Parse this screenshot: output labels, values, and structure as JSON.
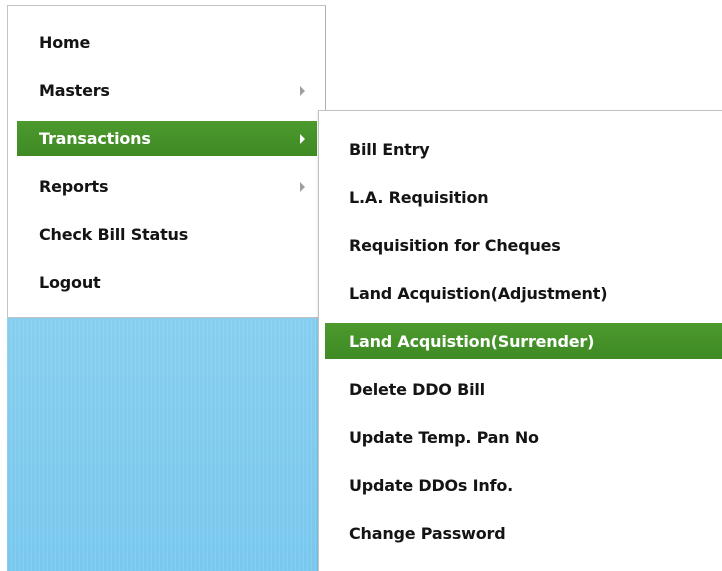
{
  "main_menu": {
    "items": [
      {
        "label": "Home",
        "has_submenu": false,
        "active": false
      },
      {
        "label": "Masters",
        "has_submenu": true,
        "active": false
      },
      {
        "label": "Transactions",
        "has_submenu": true,
        "active": true
      },
      {
        "label": "Reports",
        "has_submenu": true,
        "active": false
      },
      {
        "label": "Check Bill Status",
        "has_submenu": false,
        "active": false
      },
      {
        "label": "Logout",
        "has_submenu": false,
        "active": false
      }
    ]
  },
  "submenu_transactions": {
    "items": [
      {
        "label": "Bill Entry",
        "active": false
      },
      {
        "label": "L.A. Requisition",
        "active": false
      },
      {
        "label": "Requisition for Cheques",
        "active": false
      },
      {
        "label": "Land Acquistion(Adjustment)",
        "active": false
      },
      {
        "label": "Land Acquistion(Surrender)",
        "active": true
      },
      {
        "label": "Delete DDO Bill",
        "active": false
      },
      {
        "label": "Update Temp. Pan No",
        "active": false
      },
      {
        "label": "Update DDOs Info.",
        "active": false
      },
      {
        "label": "Change Password",
        "active": false
      }
    ]
  },
  "colors": {
    "active_bg": "#418c26",
    "active_text": "#ffffff",
    "text": "#141414",
    "backdrop": "#7fcbef",
    "arrow": "#a0a0a0"
  },
  "icons": {
    "submenu_arrow": "caret-right-icon"
  }
}
